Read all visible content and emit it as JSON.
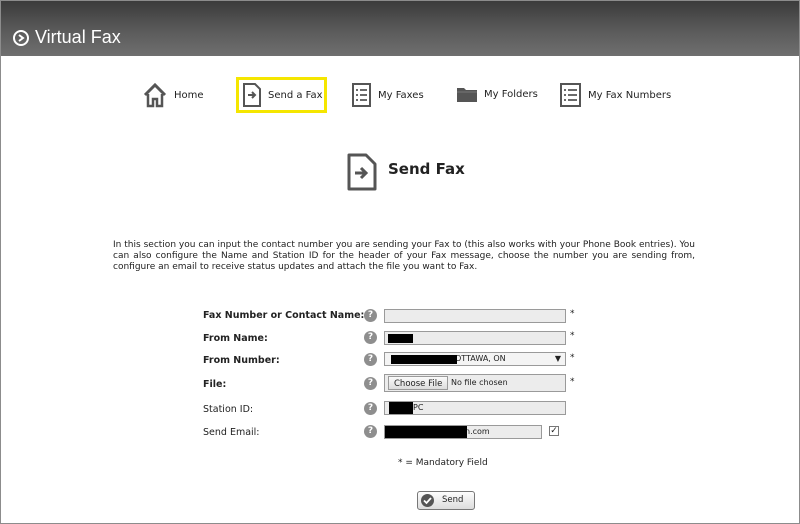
{
  "app": {
    "title": "Virtual Fax"
  },
  "nav": {
    "items": [
      {
        "label": "Home",
        "icon": "home-icon"
      },
      {
        "label": "Send a Fax",
        "icon": "send-fax-icon",
        "active": true
      },
      {
        "label": "My Faxes",
        "icon": "list-icon"
      },
      {
        "label": "My Folders",
        "icon": "folder-icon"
      },
      {
        "label": "My Fax Numbers",
        "icon": "list-icon"
      }
    ],
    "highlight_color": "#f5e600"
  },
  "page": {
    "title": "Send Fax",
    "intro": "In this section you can input the contact number you are sending your Fax to (this also works with your Phone Book entries). You can also configure the Name and Station ID for the header of your Fax message, choose the number you are sending from, configure an email to receive status updates and attach the file you want to Fax."
  },
  "form": {
    "fax_number_label": "Fax Number or Contact Name:",
    "fax_number_value": "",
    "from_name_label": "From Name:",
    "from_number_label": "From Number:",
    "from_number_value": "OTTAWA, ON",
    "file_label": "File:",
    "file_button": "Choose File",
    "file_status": "No file chosen",
    "station_id_label": "Station ID:",
    "station_id_value": "PC",
    "send_email_label": "Send Email:",
    "send_email_value": "n.com",
    "send_email_checked": true,
    "help_symbol": "?",
    "required_marker": "*",
    "mandatory_note": "* = Mandatory Field",
    "submit_label": "Send"
  }
}
